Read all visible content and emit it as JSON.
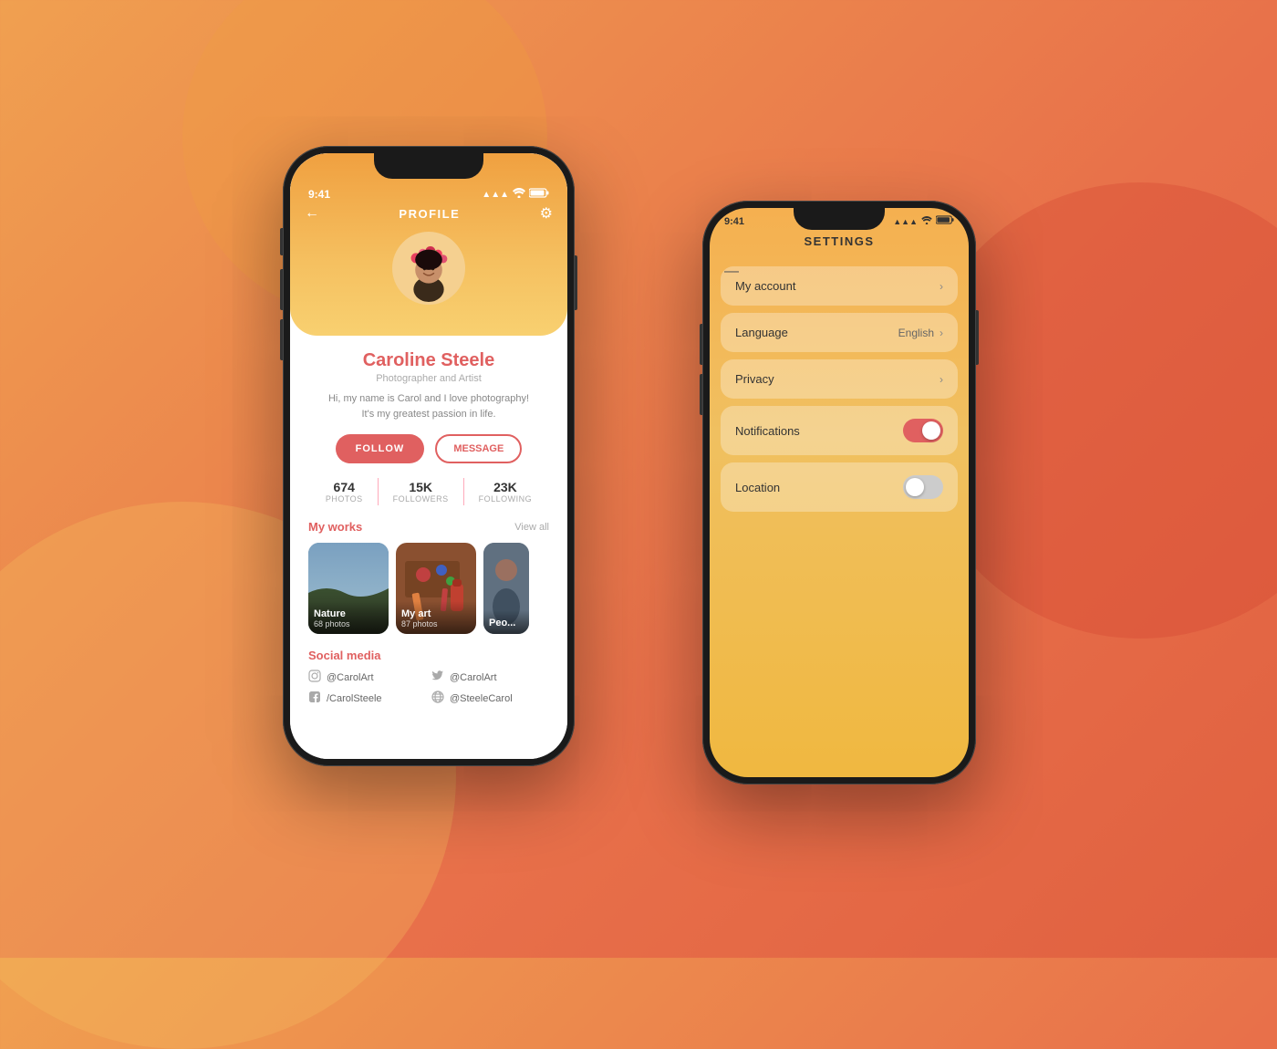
{
  "background": {
    "gradient_start": "#f0a050",
    "gradient_end": "#e06040"
  },
  "phone1": {
    "screen": "profile",
    "status_bar": {
      "time": "9:41",
      "signal": "●●●●",
      "wifi": "WiFi",
      "battery": "Battery"
    },
    "nav": {
      "title": "PROFILE",
      "back_icon": "←",
      "settings_icon": "⚙"
    },
    "profile": {
      "name": "Caroline Steele",
      "subtitle": "Photographer and Artist",
      "bio_line1": "Hi, my name is Carol and I love photography!",
      "bio_line2": "It's my greatest passion in life.",
      "follow_label": "FOLLOW",
      "message_label": "MESSAGE",
      "stats": [
        {
          "number": "674",
          "label": "PHOTOS"
        },
        {
          "number": "15K",
          "label": "FOLLOWERS"
        },
        {
          "number": "23K",
          "label": "FOLLOWING"
        }
      ],
      "works_section_title": "My works",
      "works_view_all": "View all",
      "works": [
        {
          "title": "Nature",
          "count": "68 photos"
        },
        {
          "title": "My art",
          "count": "87 photos"
        },
        {
          "title": "Peo...",
          "count": ""
        }
      ],
      "social_section_title": "Social media",
      "social_items": [
        {
          "icon": "instagram",
          "handle": "@CarolArt"
        },
        {
          "icon": "twitter",
          "handle": "@CarolArt"
        },
        {
          "icon": "facebook",
          "handle": "/CarolSteele"
        },
        {
          "icon": "globe",
          "handle": "@SteeleCarol"
        }
      ]
    }
  },
  "phone2": {
    "screen": "settings",
    "status_bar": {
      "time": "9:41",
      "signal": "●●●●",
      "wifi": "WiFi",
      "battery": "Battery"
    },
    "nav": {
      "title": "SETTINGS",
      "back_icon": "—"
    },
    "settings_items": [
      {
        "label": "My account",
        "type": "nav",
        "value": ""
      },
      {
        "label": "Language",
        "type": "nav",
        "value": "English"
      },
      {
        "label": "Privacy",
        "type": "nav",
        "value": ""
      },
      {
        "label": "Notifications",
        "type": "toggle",
        "value": true
      },
      {
        "label": "Location",
        "type": "toggle",
        "value": false
      }
    ]
  }
}
